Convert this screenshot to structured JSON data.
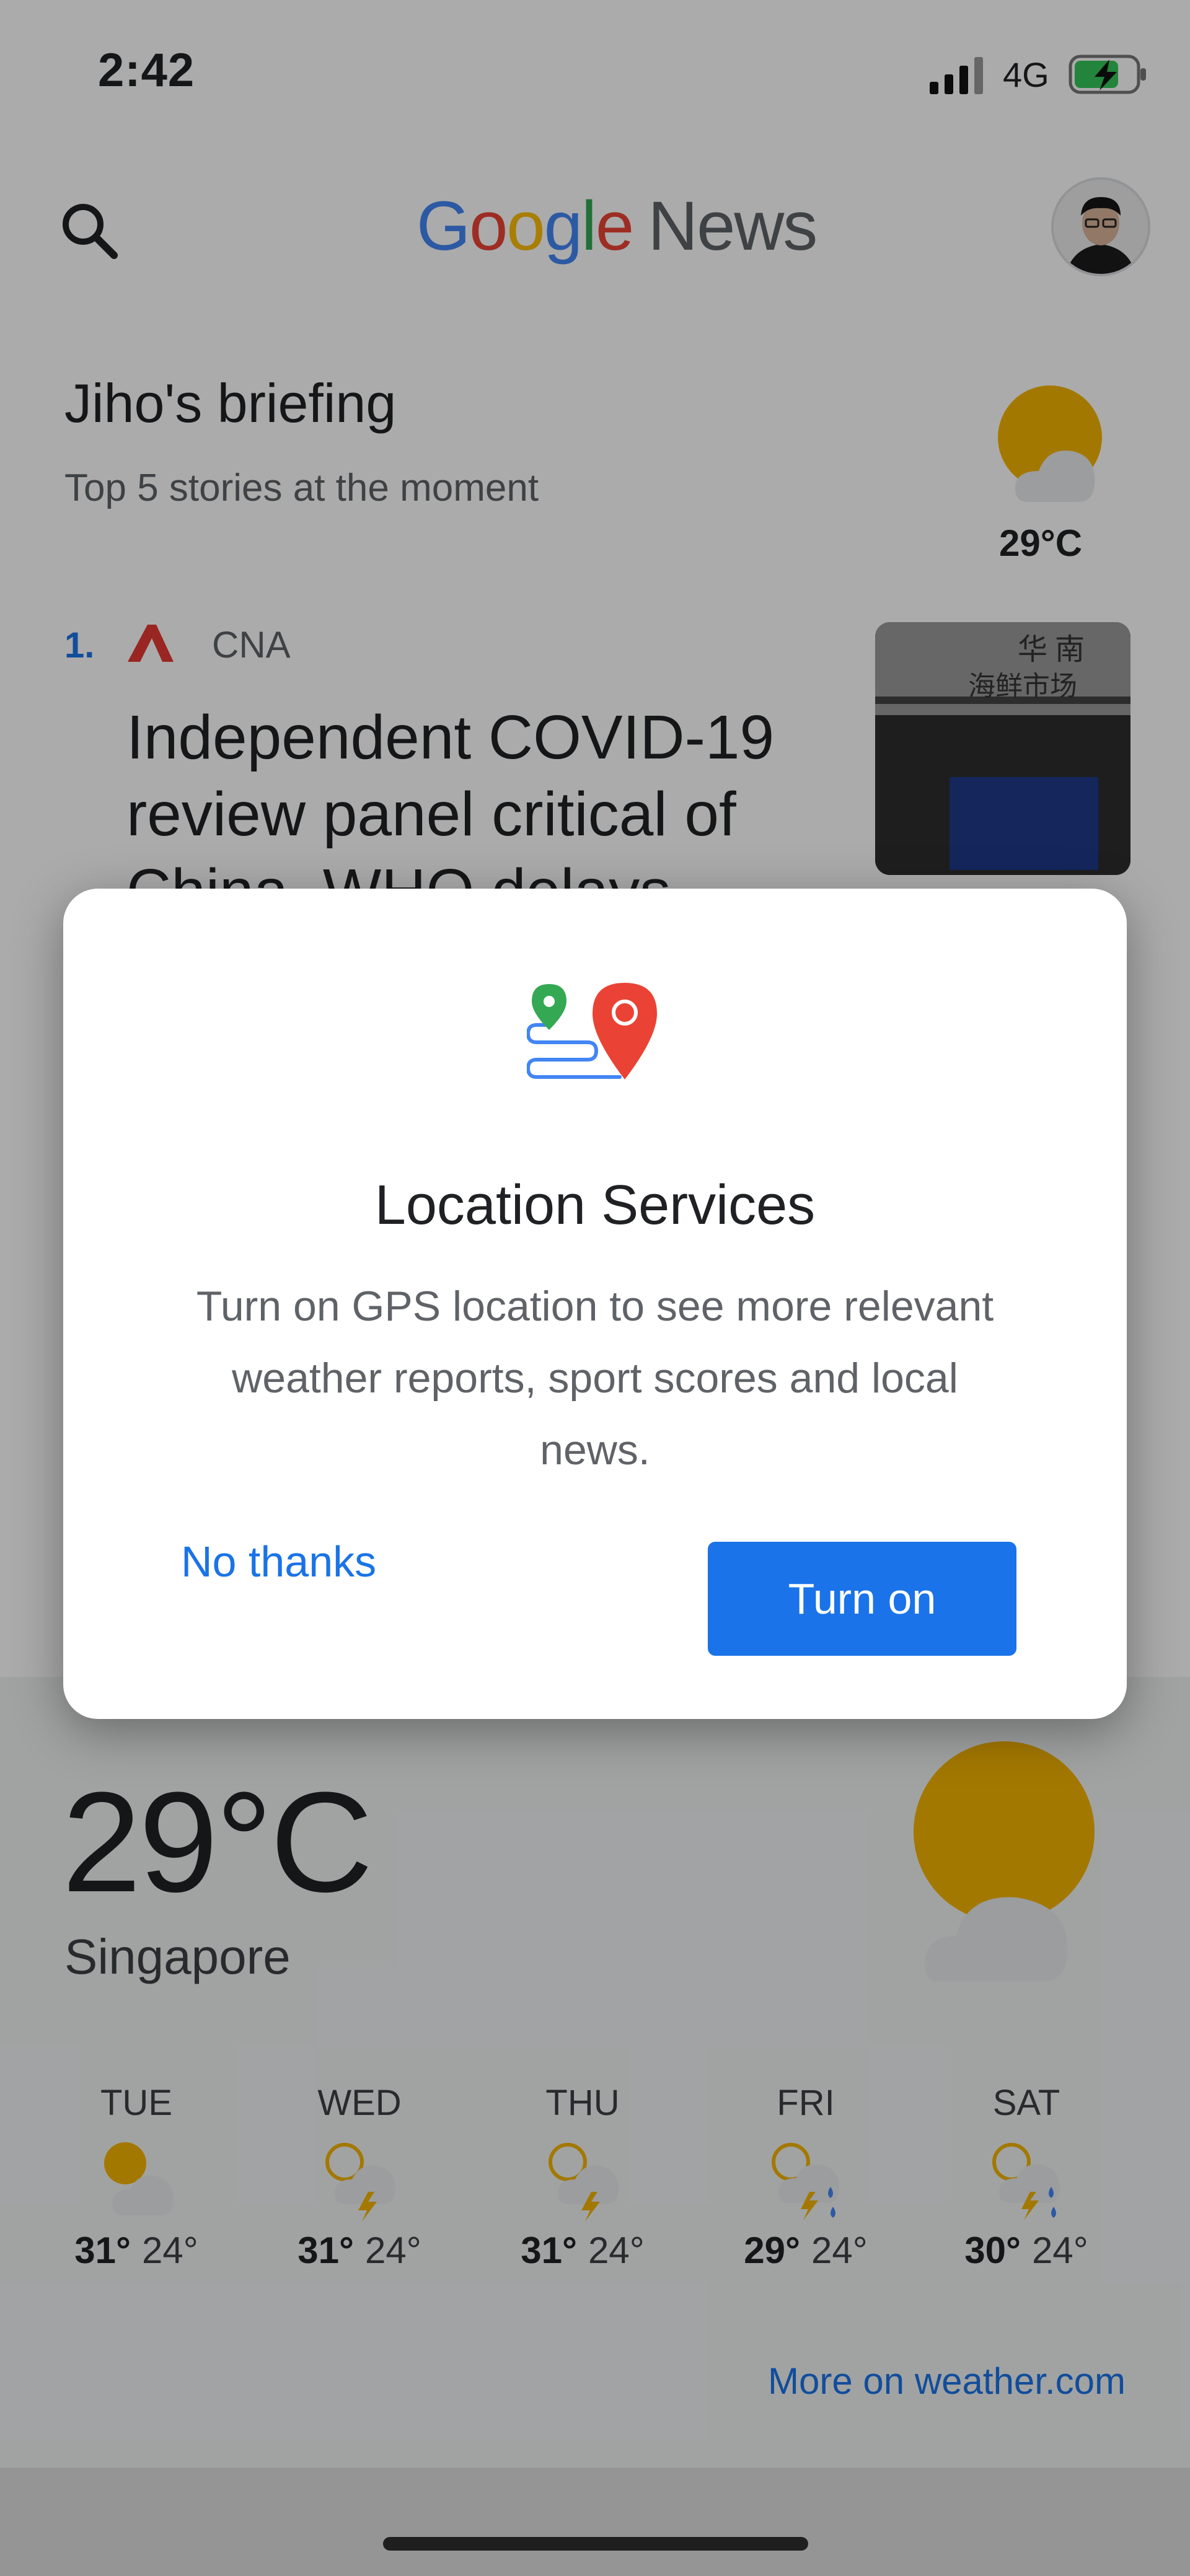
{
  "status_bar": {
    "time": "2:42",
    "network": "4G"
  },
  "header": {
    "logo_letters": [
      "G",
      "o",
      "o",
      "g",
      "l",
      "e"
    ],
    "logo_news": "News",
    "icons": {
      "search": "search-icon",
      "avatar": "avatar"
    }
  },
  "briefing": {
    "title": "Jiho's briefing",
    "subtitle": "Top 5 stories at the moment",
    "temp": "29°C"
  },
  "story": {
    "number": "1.",
    "source": "CNA",
    "headline": "Independent COVID-19 review panel critical of China, WHO delays"
  },
  "weather": {
    "temp": "29°C",
    "city": "Singapore",
    "link": "More on weather.com",
    "forecast": [
      {
        "day": "TUE",
        "high": "31°",
        "low": "24°",
        "icon": "partly-cloudy-icon"
      },
      {
        "day": "WED",
        "high": "31°",
        "low": "24°",
        "icon": "thunderstorm-icon"
      },
      {
        "day": "THU",
        "high": "31°",
        "low": "24°",
        "icon": "thunderstorm-icon"
      },
      {
        "day": "FRI",
        "high": "29°",
        "low": "24°",
        "icon": "thunder-rain-icon"
      },
      {
        "day": "SAT",
        "high": "30°",
        "low": "24°",
        "icon": "thunder-rain-icon"
      }
    ]
  },
  "dialog": {
    "title": "Location Services",
    "body": "Turn on GPS location to see more relevant weather reports, sport scores and local news.",
    "cancel_label": "No thanks",
    "confirm_label": "Turn on",
    "icon": "location-route-icon"
  },
  "colors": {
    "accent": "#1a73e8",
    "sun": "#f4b400",
    "scrim": "rgba(0,0,0,0.33)"
  }
}
